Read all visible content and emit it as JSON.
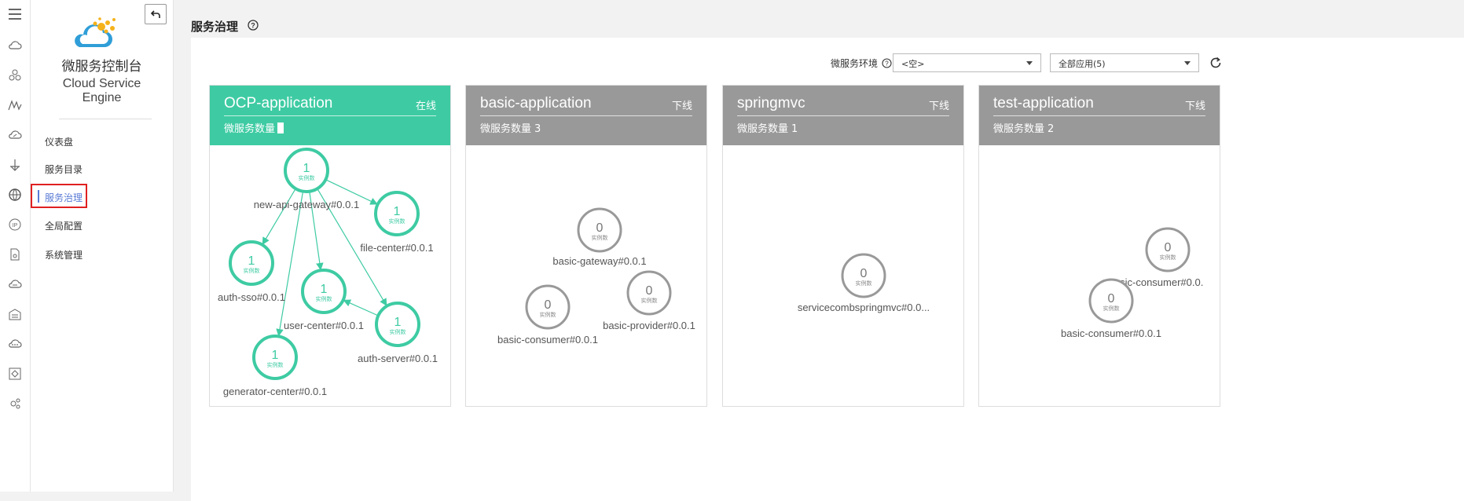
{
  "rail": {
    "icons": [
      "menu-icon",
      "cloud-icon",
      "cluster-icon",
      "mountain-icon",
      "cloud-service-icon",
      "upload-icon",
      "globe-icon",
      "ip-icon",
      "document-icon",
      "network-icon",
      "storage-icon",
      "more-icon",
      "target-icon",
      "settings-icon"
    ]
  },
  "sidenav": {
    "brand_cn": "微服务控制台",
    "brand_en": "Cloud Service Engine",
    "items": [
      {
        "label": "仪表盘"
      },
      {
        "label": "服务目录"
      },
      {
        "label": "服务治理"
      },
      {
        "label": "全局配置"
      },
      {
        "label": "系统管理"
      }
    ],
    "active_index": 2
  },
  "header": {
    "title": "服务治理"
  },
  "toolbar": {
    "env_label": "微服务环境",
    "env_value": "<空>",
    "app_filter_value": "全部应用(5)"
  },
  "colors": {
    "online": "#3ecba3",
    "offline": "#999999",
    "accent": "#5a7bd6",
    "highlight": "#e02020"
  },
  "apps": [
    {
      "name": "OCP-application",
      "status": "在线",
      "count_label": "微服务数量",
      "count": "",
      "online": true,
      "instance_label": "实例数",
      "services": [
        {
          "name": "new-api-gateway#0.0.1",
          "instances": "1"
        },
        {
          "name": "file-center#0.0.1",
          "instances": "1"
        },
        {
          "name": "auth-sso#0.0.1",
          "instances": "1"
        },
        {
          "name": "user-center#0.0.1",
          "instances": "1"
        },
        {
          "name": "auth-server#0.0.1",
          "instances": "1"
        },
        {
          "name": "generator-center#0.0.1",
          "instances": "1"
        }
      ]
    },
    {
      "name": "basic-application",
      "status": "下线",
      "count_label": "微服务数量",
      "count": "3",
      "online": false,
      "instance_label": "实例数",
      "services": [
        {
          "name": "basic-gateway#0.0.1",
          "instances": "0"
        },
        {
          "name": "basic-consumer#0.0.1",
          "instances": "0"
        },
        {
          "name": "basic-provider#0.0.1",
          "instances": "0"
        }
      ]
    },
    {
      "name": "springmvc",
      "status": "下线",
      "count_label": "微服务数量",
      "count": "1",
      "online": false,
      "instance_label": "实例数",
      "services": [
        {
          "name": "servicecombspringmvc#0.0...",
          "instances": "0"
        }
      ]
    },
    {
      "name": "test-application",
      "status": "下线",
      "count_label": "微服务数量",
      "count": "2",
      "online": false,
      "instance_label": "实例数",
      "services": [
        {
          "name": "basic-consumer#0.0.",
          "instances": "0"
        },
        {
          "name": "basic-consumer#0.0.1",
          "instances": "0"
        }
      ]
    }
  ]
}
